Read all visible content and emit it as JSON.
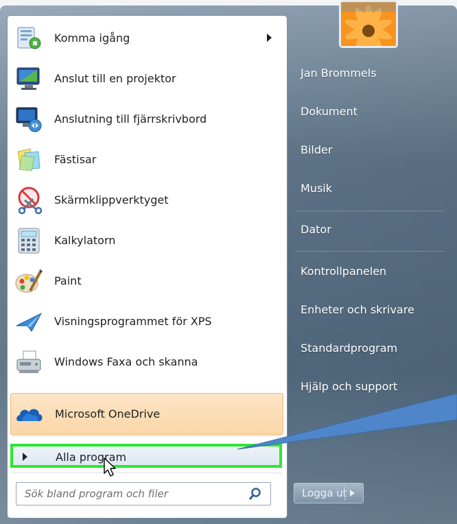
{
  "menu": {
    "items": [
      {
        "label": "Komma igång",
        "icon": "getting-started-icon",
        "has_submenu": true
      },
      {
        "label": "Anslut till en projektor",
        "icon": "projector-icon"
      },
      {
        "label": "Anslutning till fjärrskrivbord",
        "icon": "remote-desktop-icon"
      },
      {
        "label": "Fästisar",
        "icon": "sticky-notes-icon"
      },
      {
        "label": "Skärmklippverktyget",
        "icon": "snipping-tool-icon"
      },
      {
        "label": "Kalkylatorn",
        "icon": "calculator-icon"
      },
      {
        "label": "Paint",
        "icon": "paint-icon"
      },
      {
        "label": "Visningsprogrammet för XPS",
        "icon": "xps-viewer-icon"
      },
      {
        "label": "Windows Faxa och skanna",
        "icon": "fax-scan-icon"
      },
      {
        "label": "Microsoft OneDrive",
        "icon": "onedrive-icon",
        "highlighted": true
      }
    ],
    "all_programs": "Alla program",
    "search_placeholder": "Sök bland program och filer"
  },
  "right": {
    "user": "Jan Brommels",
    "links": [
      "Dokument",
      "Bilder",
      "Musik",
      "Dator",
      "Kontrollpanelen",
      "Enheter och skrivare",
      "Standardprogram",
      "Hjälp och support"
    ]
  },
  "logout": {
    "label": "Logga ut"
  },
  "colors": {
    "highlight_border": "#2ee82e",
    "callout": "#4f86c9",
    "onedrive_highlight": "#fbd6a8"
  }
}
